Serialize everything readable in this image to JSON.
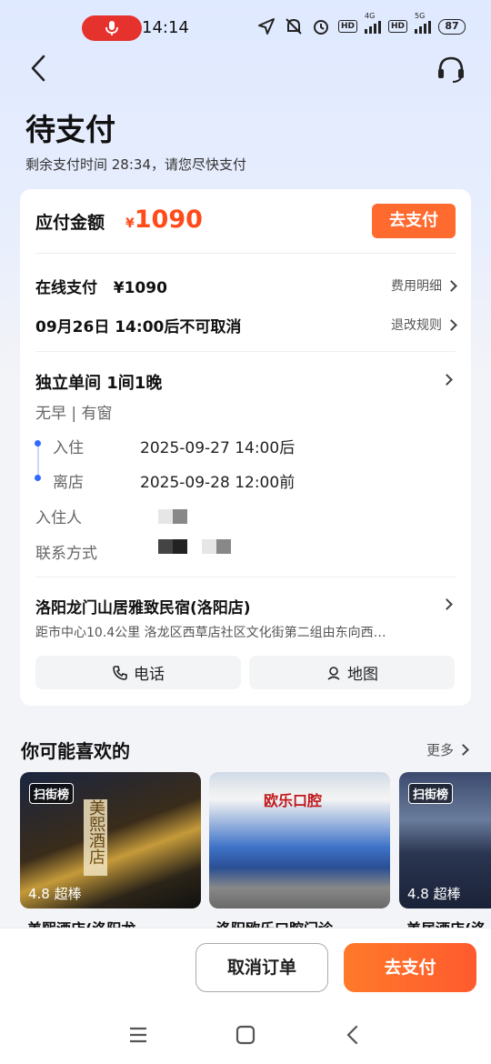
{
  "status_bar": {
    "time": "14:14",
    "network_1": "4G",
    "network_2": "5G",
    "hd_label": "HD",
    "battery": "87",
    "icons": [
      "mic-icon",
      "location-icon",
      "mute-icon",
      "alarm-icon",
      "signal-icon",
      "battery-icon"
    ]
  },
  "header": {
    "title": "待支付",
    "countdown_text": "剩余支付时间 28:34，请您尽快支付",
    "icons": [
      "back-icon",
      "customer-service-icon"
    ]
  },
  "payment": {
    "amount_label": "应付金额",
    "currency": "¥",
    "amount": "1090",
    "pay_button": "去支付",
    "online_pay_label": "在线支付",
    "online_pay_amount": "¥1090",
    "fee_detail_link": "费用明细",
    "cancel_policy": "09月26日 14:00后不可取消",
    "refund_rules_link": "退改规则"
  },
  "room": {
    "title": "独立单间 1间1晚",
    "tags": "无早 | 有窗",
    "checkin_label": "入住",
    "checkin_value": "2025-09-27 14:00后",
    "checkout_label": "离店",
    "checkout_value": "2025-09-28 12:00前",
    "guest_label": "入住人",
    "contact_label": "联系方式"
  },
  "hotel": {
    "name": "洛阳龙门山居雅致民宿(洛阳店)",
    "address": "距市中心10.4公里 洛龙区西草店社区文化街第二组由东向西…",
    "phone_button": "电话",
    "map_button": "地图"
  },
  "recommendations": {
    "title": "你可能喜欢的",
    "more": "更多",
    "items": [
      {
        "badge": "扫街榜",
        "score": "4.8 超棒",
        "name": "美熙酒店(洛阳龙",
        "sign_text": "美熙酒店"
      },
      {
        "badge": "",
        "score": "",
        "name": "洛阳欧乐口腔门诊",
        "sign_text": "欧乐口腔"
      },
      {
        "badge": "扫街榜",
        "score": "4.8 超棒",
        "name": "美居酒店(洛"
      }
    ]
  },
  "bottom_bar": {
    "cancel_button": "取消订单",
    "pay_button": "去支付"
  },
  "colors": {
    "accent": "#ff6a2e",
    "price": "#ff4a1a",
    "timeline_dot": "#2f6bff"
  }
}
